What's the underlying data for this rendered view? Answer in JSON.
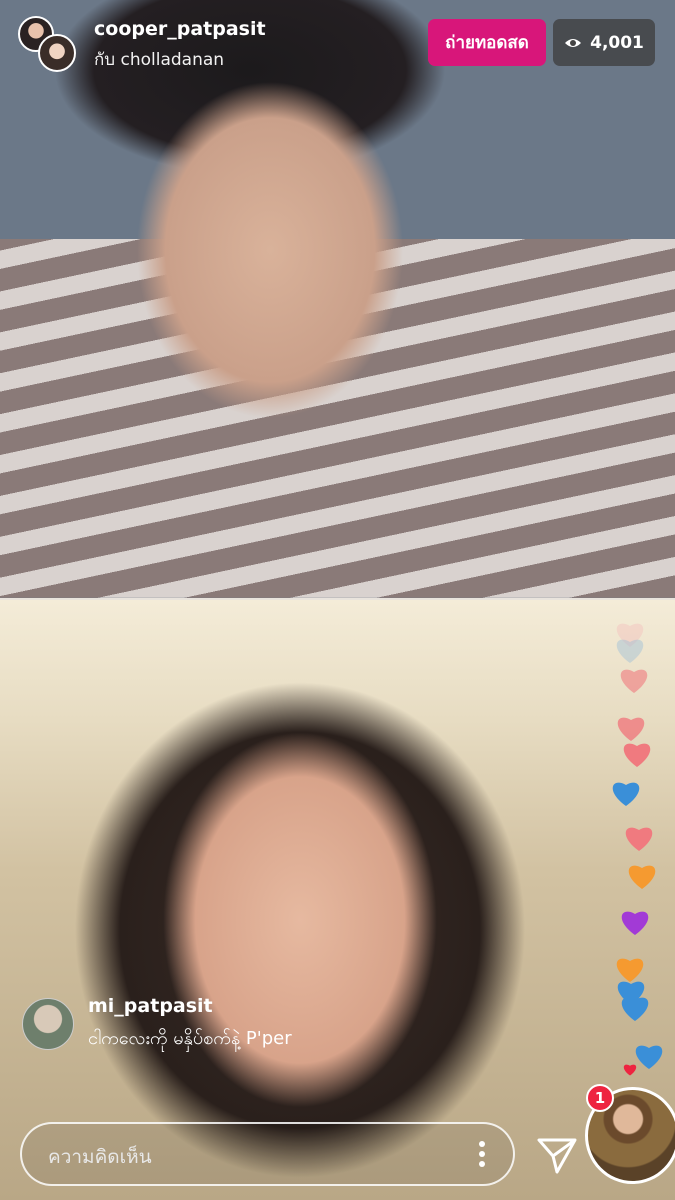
{
  "header": {
    "host_username": "cooper_patpasit",
    "with_text": "กับ cholladanan",
    "live_label": "ถ่ายทอดสด",
    "viewer_count": "4,001"
  },
  "comment": {
    "username": "mi_patpasit",
    "text": "ငါကလေးကို မနှိပ်စက်နဲ့ P'per"
  },
  "input": {
    "placeholder": "ความคิดเห็น"
  },
  "guest": {
    "badge_count": "1"
  },
  "colors": {
    "live": "#d8167a",
    "badge": "#ee2440",
    "heart_pink": "#f07a7f",
    "heart_blue": "#3a8fd8",
    "heart_orange": "#f59a30",
    "heart_purple": "#a23ad6"
  }
}
